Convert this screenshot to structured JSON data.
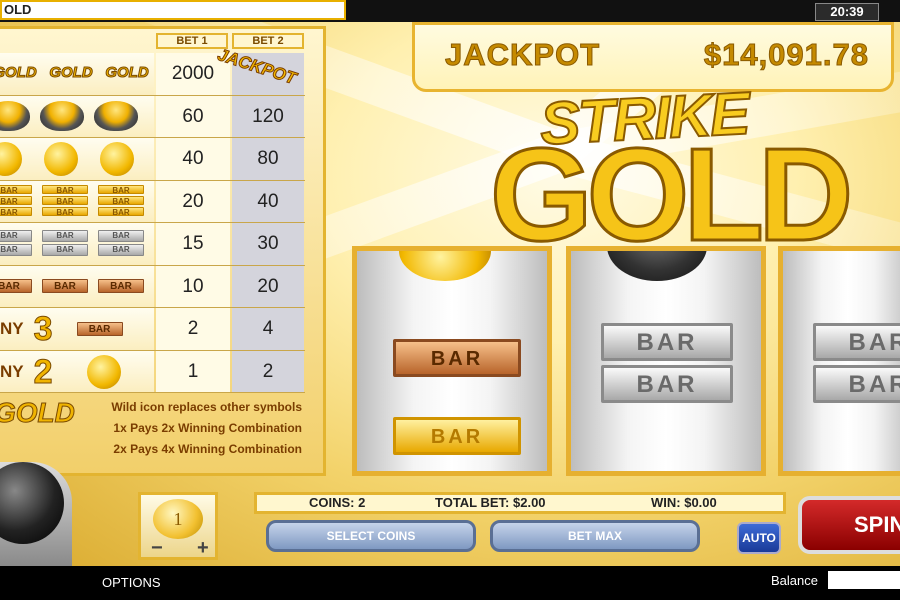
{
  "top": {
    "title": "OLD",
    "clock": "20:39"
  },
  "paytable": {
    "bet1_header": "BET 1",
    "bet2_header": "BET 2",
    "jackpot_tag": "JACKPOT",
    "rows": [
      {
        "symbol": "gold-logo",
        "bet1": "2000",
        "bet2": ""
      },
      {
        "symbol": "gold-pot",
        "bet1": "60",
        "bet2": "120"
      },
      {
        "symbol": "gold-coin",
        "bet1": "40",
        "bet2": "80"
      },
      {
        "symbol": "triple-gold-bar",
        "bet1": "20",
        "bet2": "40"
      },
      {
        "symbol": "double-silver-bar",
        "bet1": "15",
        "bet2": "30"
      },
      {
        "symbol": "bronze-bar",
        "bet1": "10",
        "bet2": "20"
      },
      {
        "symbol": "any-3",
        "bet1": "2",
        "bet2": "4"
      },
      {
        "symbol": "any-2",
        "bet1": "1",
        "bet2": "2"
      }
    ],
    "any_label_3": "NY",
    "any_num_3": "3",
    "any_label_2": "NY",
    "any_num_2": "2",
    "mini_gold": "GOLD",
    "mini_bar": "BAR",
    "logo_mini": "GOLD",
    "notes": [
      "Wild icon replaces other symbols",
      "1x Pays 2x Winning Combination",
      "2x Pays 4x Winning Combination"
    ]
  },
  "jackpot": {
    "label": "JACKPOT",
    "value": "$14,091.78"
  },
  "logo": {
    "line1": "STRIKE",
    "line2": "GOLD"
  },
  "reels": {
    "bar_label": "BAR"
  },
  "controls": {
    "coin_value": "1",
    "minus": "−",
    "plus": "+",
    "coins_text": "COINS: 2",
    "total_bet_text": "TOTAL BET: $2.00",
    "win_text": "WIN: $0.00",
    "select_coins": "SELECT COINS",
    "bet_max": "BET MAX",
    "auto": "AUTO",
    "spin": "SPIN"
  },
  "bottom": {
    "options": "OPTIONS",
    "balance_label": "Balance"
  },
  "colors": {
    "gold": "#f0b400",
    "frame": "#e3b430",
    "spin_red": "#c41e1e",
    "button_blue": "#7f99c2"
  }
}
